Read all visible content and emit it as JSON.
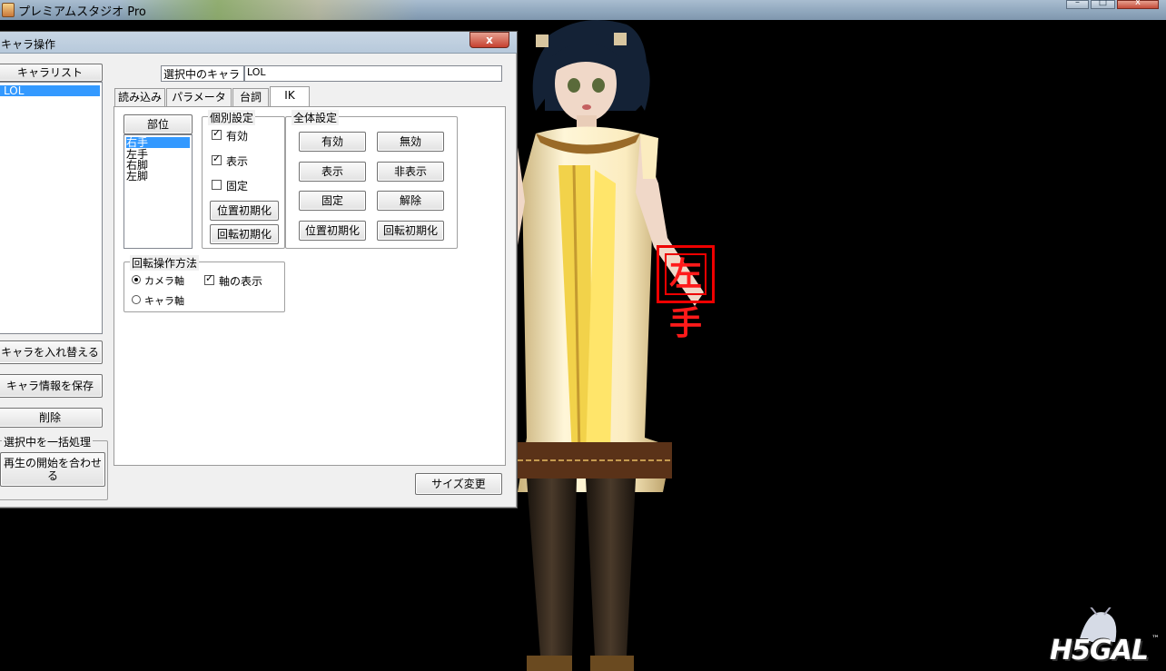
{
  "app": {
    "title": "プレミアムスタジオ Pro",
    "window_controls": {
      "minimize": "–",
      "maximize": "□",
      "close": "x"
    }
  },
  "dialog": {
    "title": "キャラ操作",
    "close_label": "x",
    "chara_list": {
      "header": "キャラリスト",
      "items": [
        "LOL"
      ],
      "selected_index": 0
    },
    "left_buttons": {
      "swap": "キャラを入れ替える",
      "save_info": "キャラ情報を保存",
      "delete": "削除"
    },
    "batch": {
      "title": "選択中を一括処理",
      "sync_play": "再生の開始を合わせる"
    },
    "selected_chara": {
      "label": "選択中のキャラ",
      "value": "LOL"
    },
    "tabs": [
      {
        "label": "読み込み",
        "active": false
      },
      {
        "label": "パラメータ",
        "active": false
      },
      {
        "label": "台詞",
        "active": false
      },
      {
        "label": "IK",
        "active": true
      }
    ],
    "ik": {
      "part_header": "部位",
      "parts": [
        "右手",
        "左手",
        "右脚",
        "左脚"
      ],
      "selected_part": 0,
      "individual": {
        "title": "個別設定",
        "enabled": {
          "label": "有効",
          "checked": true
        },
        "visible": {
          "label": "表示",
          "checked": true
        },
        "fixed": {
          "label": "固定",
          "checked": false
        },
        "reset_pos": "位置初期化",
        "reset_rot": "回転初期化"
      },
      "global": {
        "title": "全体設定",
        "enable": "有効",
        "disable": "無効",
        "show": "表示",
        "hide": "非表示",
        "fix": "固定",
        "release": "解除",
        "reset_pos": "位置初期化",
        "reset_rot": "回転初期化"
      },
      "rotation": {
        "title": "回転操作方法",
        "camera_axis": {
          "label": "カメラ軸",
          "selected": true
        },
        "chara_axis": {
          "label": "キャラ軸",
          "selected": false
        },
        "show_axis": {
          "label": "軸の表示",
          "checked": true
        }
      }
    },
    "size_change": "サイズ変更"
  },
  "viewport": {
    "ik_marker_label": "左手",
    "watermark": "H5GAL",
    "watermark_tm": "™"
  }
}
